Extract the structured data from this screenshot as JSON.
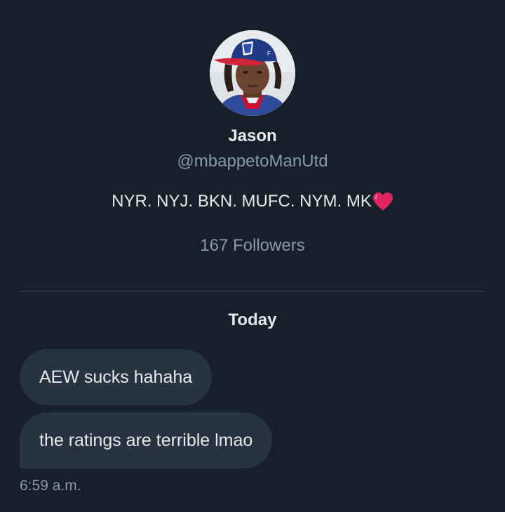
{
  "profile": {
    "name": "Jason",
    "handle": "@mbappetoManUtd",
    "bio": "NYR. NYJ. BKN. MUFC. NYM. MK",
    "bio_emoji": "heart-emoji",
    "followers": "167 Followers"
  },
  "conversation": {
    "day_label": "Today",
    "messages": [
      {
        "text": "AEW sucks hahaha"
      },
      {
        "text": "the ratings are terrible lmao"
      }
    ],
    "timestamp": "6:59 a.m."
  },
  "colors": {
    "background": "#15202b",
    "bubble": "#273340",
    "primary_text": "#e7e9ea",
    "secondary_text": "#8b98a5",
    "divider": "#38444d",
    "heart": "#e0245e"
  }
}
